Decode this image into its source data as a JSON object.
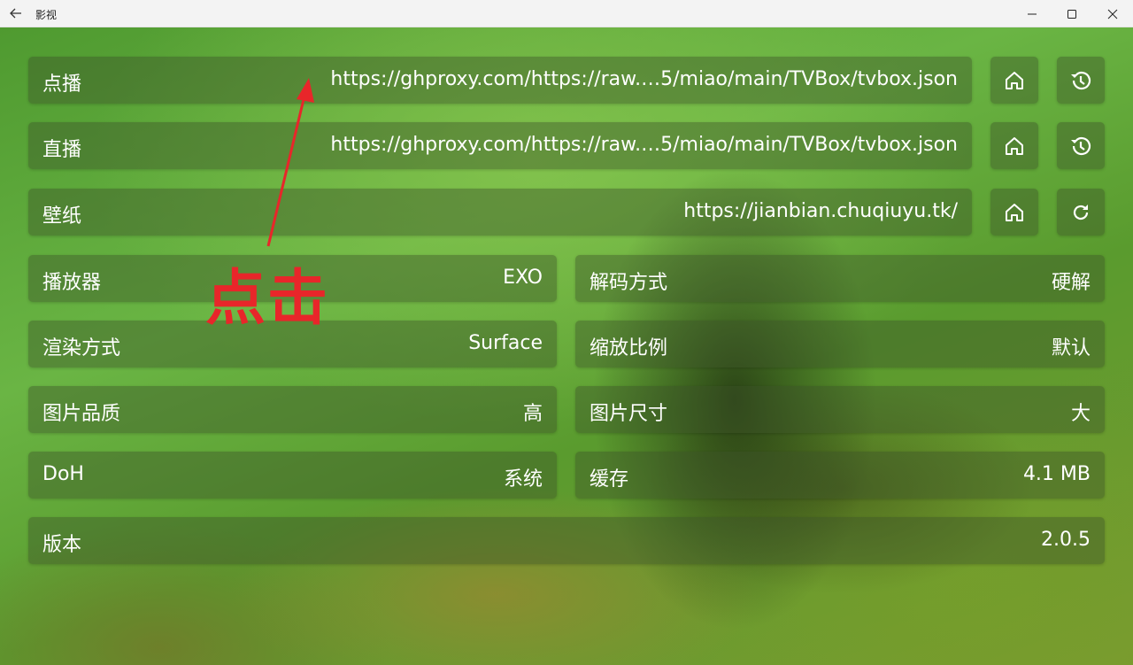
{
  "window": {
    "title": "影视"
  },
  "settings": {
    "vod": {
      "label": "点播",
      "value": "https://ghproxy.com/https://raw.…5/miao/main/TVBox/tvbox.json"
    },
    "live": {
      "label": "直播",
      "value": "https://ghproxy.com/https://raw.…5/miao/main/TVBox/tvbox.json"
    },
    "wallpaper": {
      "label": "壁纸",
      "value": "https://jianbian.chuqiuyu.tk/"
    },
    "player": {
      "label": "播放器",
      "value": "EXO"
    },
    "decode": {
      "label": "解码方式",
      "value": "硬解"
    },
    "render": {
      "label": "渲染方式",
      "value": "Surface"
    },
    "scale": {
      "label": "缩放比例",
      "value": "默认"
    },
    "image_quality": {
      "label": "图片品质",
      "value": "高"
    },
    "image_size": {
      "label": "图片尺寸",
      "value": "大"
    },
    "doh": {
      "label": "DoH",
      "value": "系统"
    },
    "cache": {
      "label": "缓存",
      "value": "4.1 MB"
    },
    "version": {
      "label": "版本",
      "value": "2.0.5"
    }
  },
  "icons": {
    "back": "arrow-left",
    "home": "home",
    "history": "history",
    "refresh": "refresh",
    "minimize": "minimize",
    "maximize": "maximize",
    "close": "close"
  },
  "annotation": {
    "text": "点击",
    "color": "#e8262a"
  }
}
